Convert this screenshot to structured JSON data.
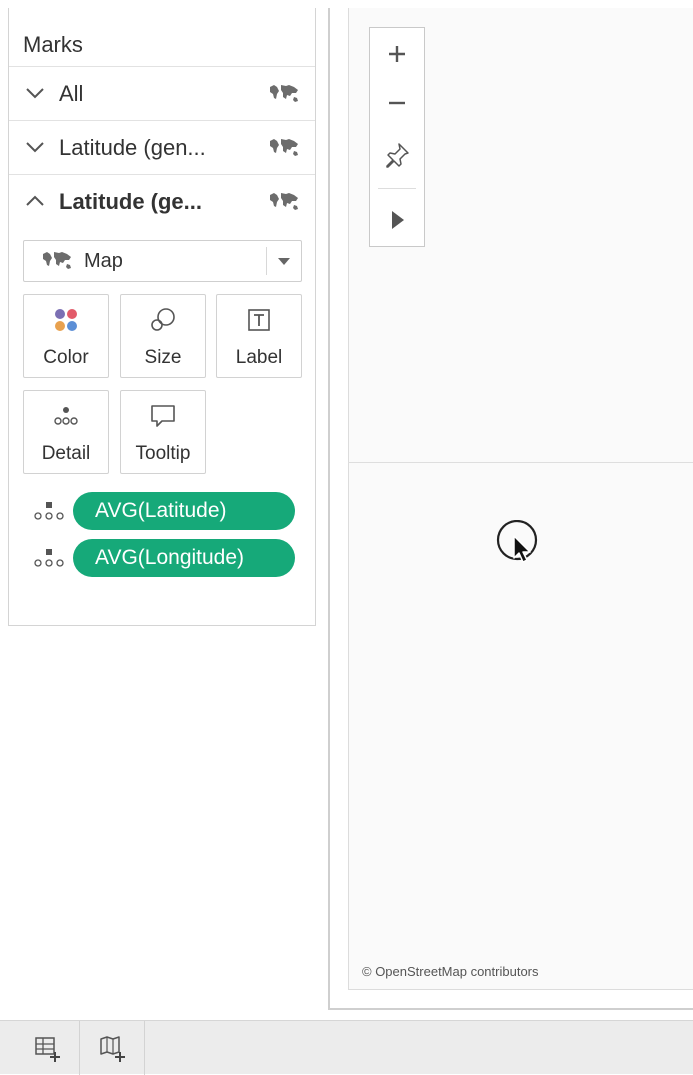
{
  "marks": {
    "title": "Marks",
    "cards": [
      {
        "label": "All",
        "expanded": false,
        "icon": "map-icon"
      },
      {
        "label": "Latitude (gen...",
        "expanded": false,
        "icon": "map-icon"
      },
      {
        "label": "Latitude (ge...",
        "expanded": true,
        "icon": "map-icon"
      }
    ],
    "mark_type": "Map",
    "tiles": [
      {
        "label": "Color",
        "icon": "color-icon"
      },
      {
        "label": "Size",
        "icon": "size-icon"
      },
      {
        "label": "Label",
        "icon": "label-icon"
      },
      {
        "label": "Detail",
        "icon": "detail-icon"
      },
      {
        "label": "Tooltip",
        "icon": "tooltip-icon"
      }
    ],
    "pills": [
      {
        "label": "AVG(Latitude)",
        "icon": "detail-icon"
      },
      {
        "label": "AVG(Longitude)",
        "icon": "detail-icon"
      }
    ]
  },
  "map": {
    "tools": [
      "zoom-in-icon",
      "zoom-out-icon",
      "pin-icon",
      "expand-arrow-icon"
    ],
    "credits": "© OpenStreetMap contributors"
  },
  "tabbar": {
    "buttons": [
      "new-worksheet-icon",
      "new-dashboard-icon"
    ]
  },
  "colors": {
    "pill": "#16a979",
    "color_dots": [
      "#7b6fb3",
      "#e25b6a",
      "#e8a14f",
      "#5c8fd6"
    ]
  }
}
